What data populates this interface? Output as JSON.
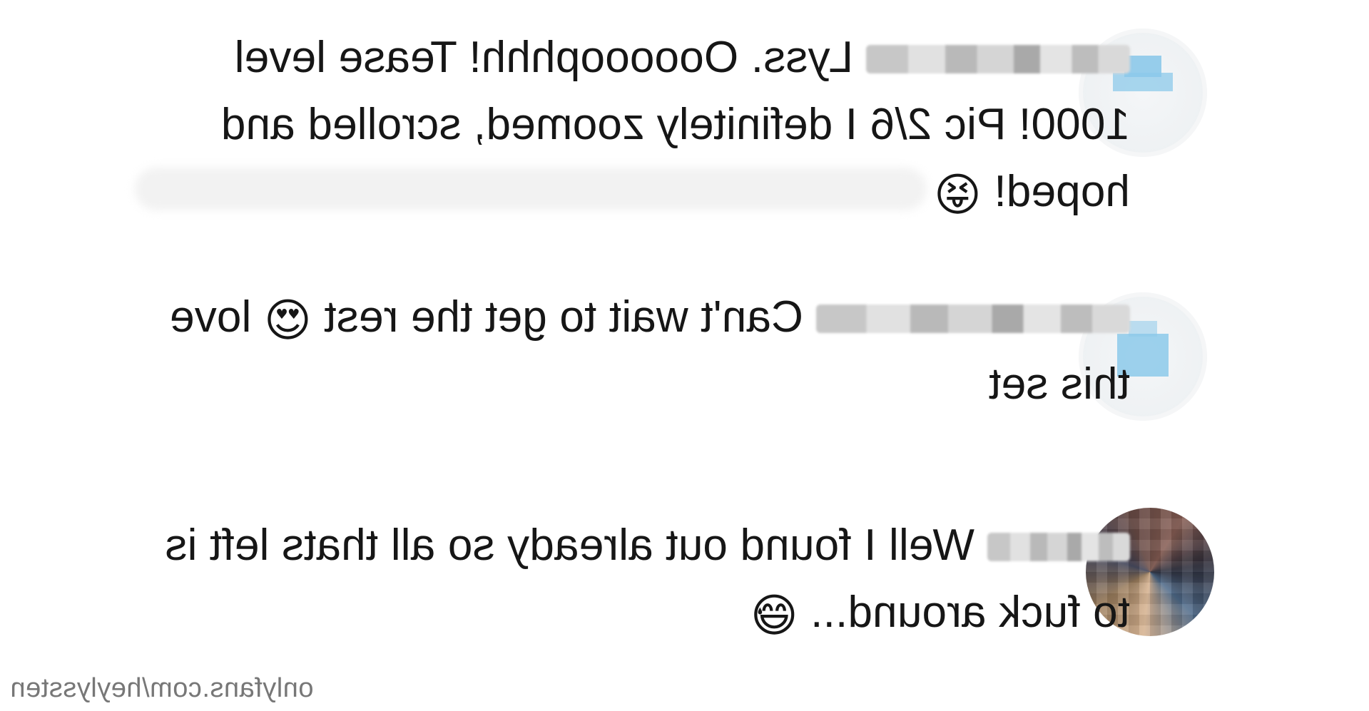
{
  "comments": [
    {
      "avatar": "pixelated-avatar-blue",
      "lines": [
        "Lyss. Oooooophhh! Tease level",
        "1000! Pic 2/6 I definitely zoomed, scrolled and",
        "hoped!"
      ],
      "emoji": "😝"
    },
    {
      "avatar": "pixelated-avatar-blue",
      "lines_before_emoji": "Can't wait to get the rest",
      "emoji": "😍",
      "lines_after_emoji": "love",
      "line2": "this set"
    },
    {
      "avatar": "pixelated-avatar-photo",
      "lines": [
        "Well I found out already so all thats left is",
        "to fuck around..."
      ],
      "emoji": "😅"
    }
  ],
  "watermark": "onlyfans.com/heylyssten",
  "colors": {
    "text": "#161616",
    "watermark": "#777777",
    "avatar_accent": "#8cc9ea",
    "background": "#ffffff"
  }
}
